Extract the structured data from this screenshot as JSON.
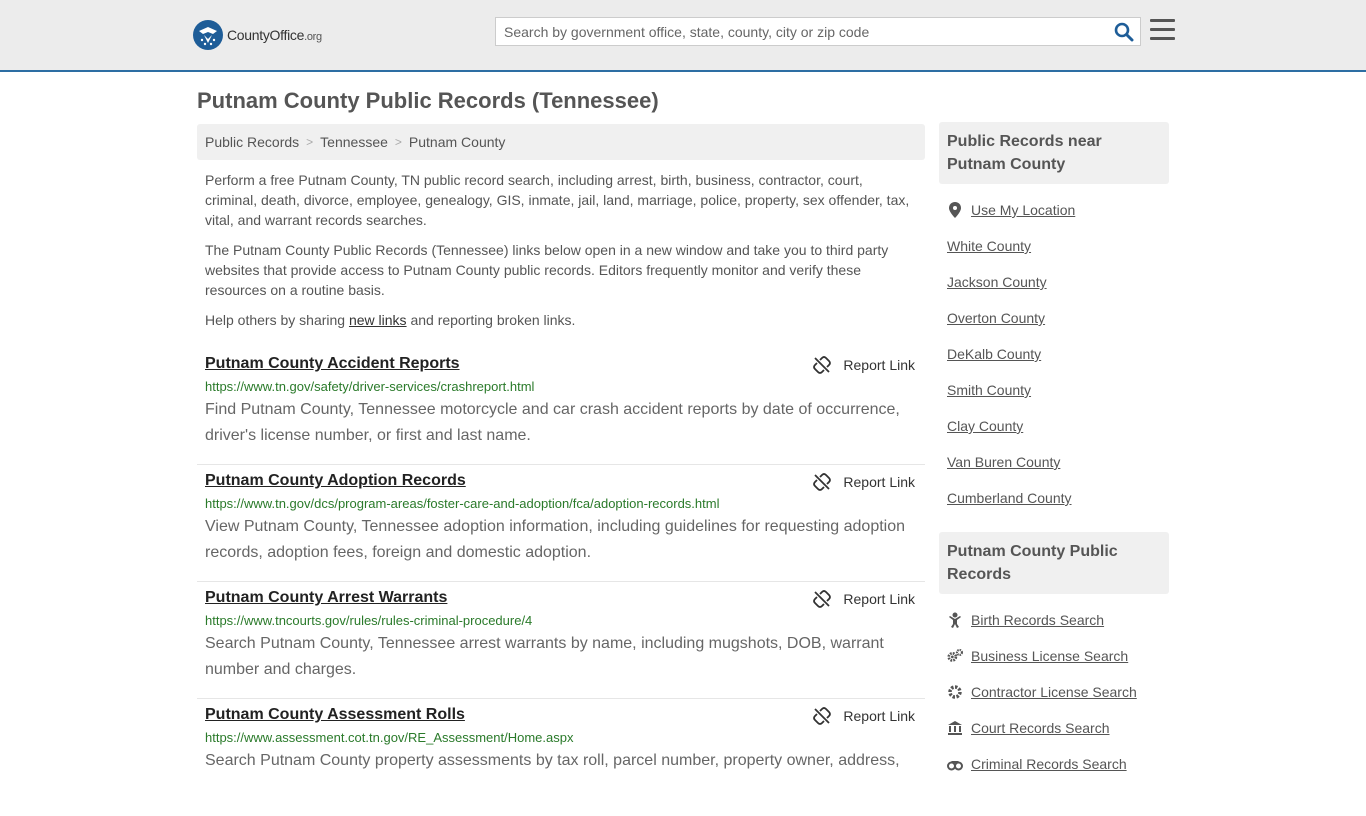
{
  "header": {
    "logo_main": "CountyOffice",
    "logo_suffix": ".org",
    "search_placeholder": "Search by government office, state, county, city or zip code"
  },
  "page_title": "Putnam County Public Records (Tennessee)",
  "breadcrumb": [
    "Public Records",
    "Tennessee",
    "Putnam County"
  ],
  "intro": {
    "p1": "Perform a free Putnam County, TN public record search, including arrest, birth, business, contractor, court, criminal, death, divorce, employee, genealogy, GIS, inmate, jail, land, marriage, police, property, sex offender, tax, vital, and warrant records searches.",
    "p2": "The Putnam County Public Records (Tennessee) links below open in a new window and take you to third party websites that provide access to Putnam County public records. Editors frequently monitor and verify these resources on a routine basis.",
    "p3_before": "Help others by sharing ",
    "p3_link": "new links",
    "p3_after": " and reporting broken links."
  },
  "report_label": "Report Link",
  "records": [
    {
      "title": "Putnam County Accident Reports",
      "url": "https://www.tn.gov/safety/driver-services/crashreport.html",
      "desc": "Find Putnam County, Tennessee motorcycle and car crash accident reports by date of occurrence, driver's license number, or first and last name."
    },
    {
      "title": "Putnam County Adoption Records",
      "url": "https://www.tn.gov/dcs/program-areas/foster-care-and-adoption/fca/adoption-records.html",
      "desc": "View Putnam County, Tennessee adoption information, including guidelines for requesting adoption records, adoption fees, foreign and domestic adoption."
    },
    {
      "title": "Putnam County Arrest Warrants",
      "url": "https://www.tncourts.gov/rules/rules-criminal-procedure/4",
      "desc": "Search Putnam County, Tennessee arrest warrants by name, including mugshots, DOB, warrant number and charges."
    },
    {
      "title": "Putnam County Assessment Rolls",
      "url": "https://www.assessment.cot.tn.gov/RE_Assessment/Home.aspx",
      "desc": "Search Putnam County property assessments by tax roll, parcel number, property owner, address,"
    }
  ],
  "sidebar": {
    "near_heading": "Public Records near Putnam County",
    "use_location": "Use My Location",
    "near_counties": [
      "White County",
      "Jackson County",
      "Overton County",
      "DeKalb County",
      "Smith County",
      "Clay County",
      "Van Buren County",
      "Cumberland County"
    ],
    "county_heading": "Putnam County Public Records",
    "county_links": [
      {
        "label": "Birth Records Search",
        "icon": "baby-icon"
      },
      {
        "label": "Business License Search",
        "icon": "gears-icon"
      },
      {
        "label": "Contractor License Search",
        "icon": "gear-icon"
      },
      {
        "label": "Court Records Search",
        "icon": "courthouse-icon"
      },
      {
        "label": "Criminal Records Search",
        "icon": "handcuffs-icon"
      }
    ]
  }
}
